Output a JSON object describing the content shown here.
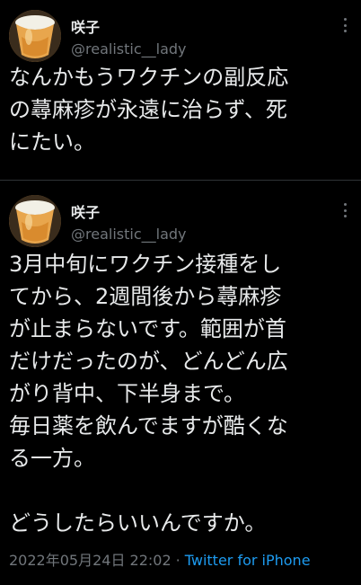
{
  "tweets": [
    {
      "name": "咲子",
      "handle": "@realistic__lady",
      "text": "なんかもうワクチンの副反応\nの蕁麻疹が永遠に治らず、死\nにたい。"
    },
    {
      "name": "咲子",
      "handle": "@realistic__lady",
      "text": "3月中旬にワクチン接種をし\nてから、2週間後から蕁麻疹\nが止まらないです。範囲が首\nだけだったのが、どんどん広\nがり背中、下半身まで。\n毎日薬を飲んでますが酷くな\nる一方。\n\nどうしたらいいんですか。",
      "timestamp": "2022年05月24日 22:02",
      "separator": "·",
      "source": "Twitter for iPhone"
    }
  ],
  "colors": {
    "background": "#000000",
    "text": "#e7e9ea",
    "secondary": "#71767b",
    "link": "#1d9bf0",
    "divider": "#2f3336"
  },
  "icons": {
    "more": "more-options-icon"
  }
}
